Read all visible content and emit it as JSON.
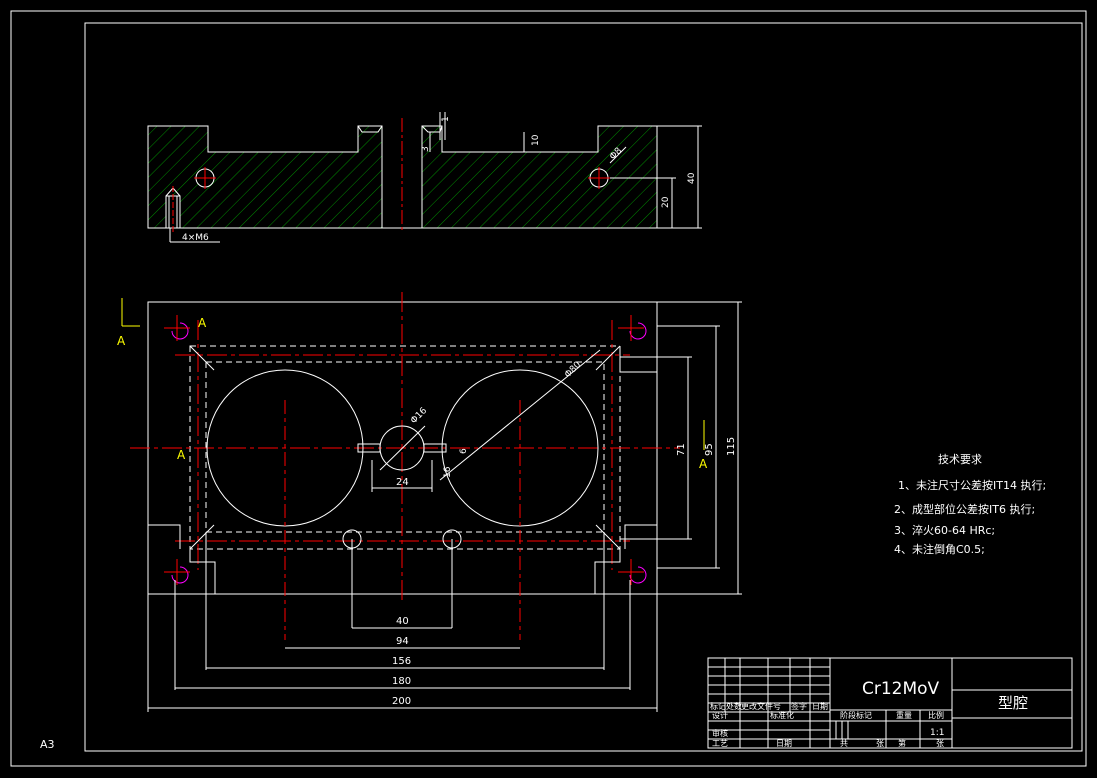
{
  "sheet": {
    "size_label": "A3"
  },
  "section_view": {
    "labels": [
      "1",
      "10",
      "3",
      "Φ8",
      "40",
      "20",
      "4×M6"
    ]
  },
  "plan_view": {
    "section_mark_left": "A",
    "section_mark_right": "A",
    "section_mark_left_2": "A",
    "section_mark_right_2": "A",
    "section_mark_left_3": "A",
    "dims": {
      "d40": "40",
      "d94": "94",
      "d156": "156",
      "d180": "180",
      "d200": "200",
      "d24": "24",
      "d71": "71",
      "d95": "95",
      "d115": "115",
      "phi16": "Φ16",
      "phi80": "Φ80",
      "d16": "16",
      "d6": "6"
    }
  },
  "tech_requirements": {
    "title": "技术要求",
    "items": [
      "1、未注尺寸公差按IT14 执行;",
      "2、成型部位公差按IT6 执行;",
      "3、淬火60-64 HRc;",
      "4、未注倒角C0.5;"
    ]
  },
  "title_block": {
    "material": "Cr12MoV",
    "part_name": "型腔",
    "scale": "1:1",
    "row_labels": [
      "标记",
      "处数",
      "更改文件号",
      "签字",
      "日期"
    ],
    "design": "设计",
    "standardization": "标准化",
    "review": "审核",
    "process": "工艺",
    "date": "日期",
    "stage_mark": "阶段标记",
    "weight": "重量",
    "ratio": "比例",
    "total": "共",
    "sheet": "张",
    "page_no": "第",
    "sheet2": "张"
  },
  "colors": {
    "background": "#000000",
    "outline": "#ffffff",
    "center_line": "#ff0000",
    "hatch": "#00c000",
    "hidden": "#ffffff",
    "thread": "#ff00ff",
    "section_arrow": "#ffff00"
  }
}
